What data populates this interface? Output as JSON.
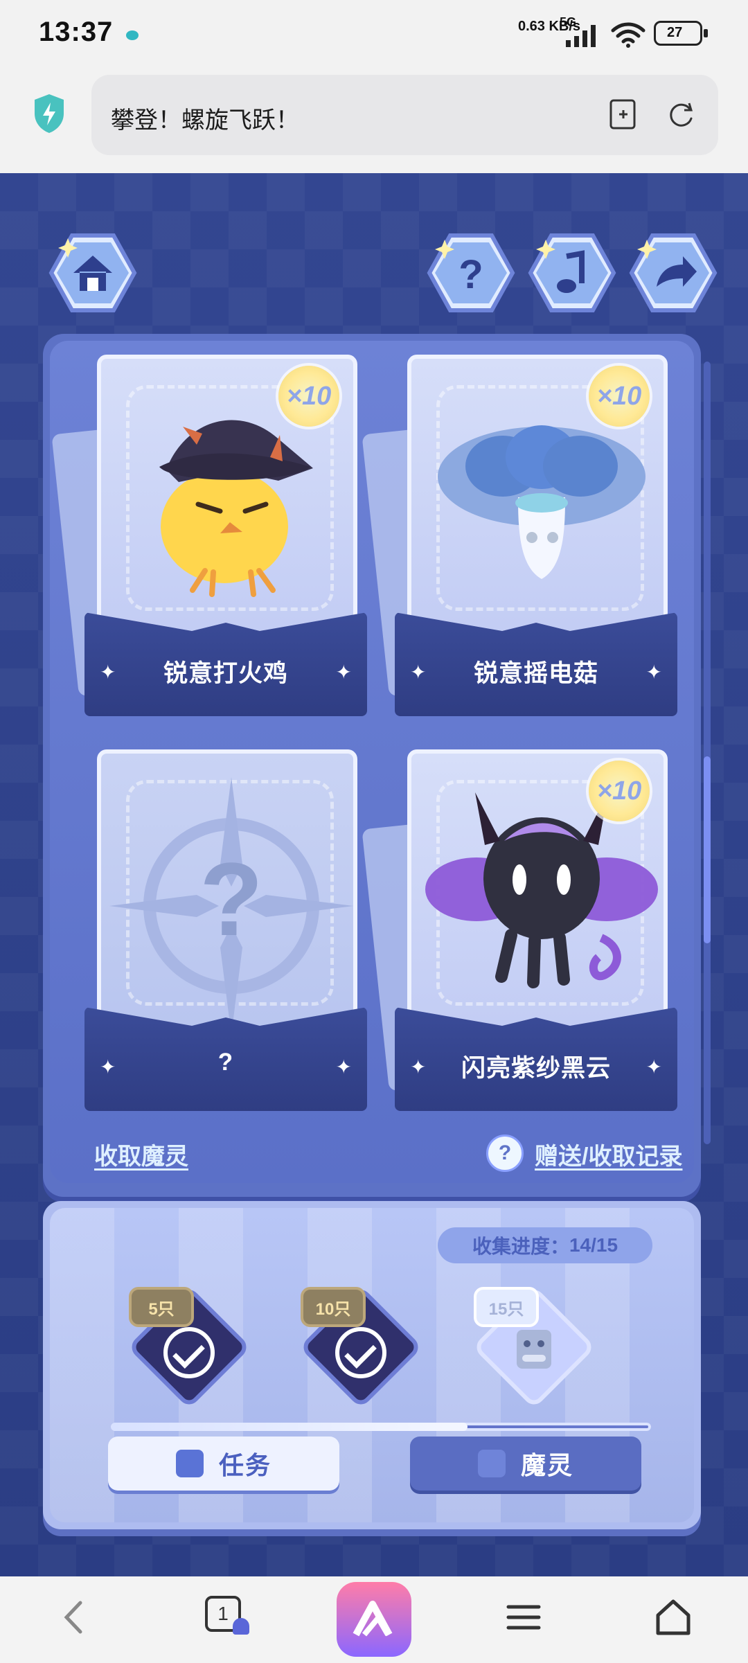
{
  "status_bar": {
    "time": "13:37",
    "network_speed": "0.63 KB/s",
    "network_type": "5G",
    "battery": "27"
  },
  "address_bar": {
    "url_text": "攀登！螺旋飞跃！"
  },
  "top_buttons": [
    {
      "name": "home",
      "icon": "home-icon"
    },
    {
      "name": "help",
      "icon": "question-icon"
    },
    {
      "name": "music",
      "icon": "music-note-icon"
    },
    {
      "name": "share",
      "icon": "share-icon"
    }
  ],
  "cards": [
    {
      "name": "锐意打火鸡",
      "badge": "×10"
    },
    {
      "name": "锐意摇电菇",
      "badge": "×10"
    },
    {
      "name": "?",
      "badge": ""
    },
    {
      "name": "闪亮紫纱黑云",
      "badge": "×10"
    }
  ],
  "links": {
    "collect": "收取魔灵",
    "record": "赠送/收取记录",
    "help_icon": "?"
  },
  "collection": {
    "label": "收集进度：",
    "value": "14/15",
    "progress": 0.66,
    "milestones": [
      {
        "label": "5只",
        "state": "claimed"
      },
      {
        "label": "10只",
        "state": "claimed"
      },
      {
        "label": "15只",
        "state": "locked"
      }
    ]
  },
  "bottom_buttons": {
    "task": "任务",
    "spirit": "魔灵"
  },
  "navbar": {
    "tab_count": "1"
  }
}
